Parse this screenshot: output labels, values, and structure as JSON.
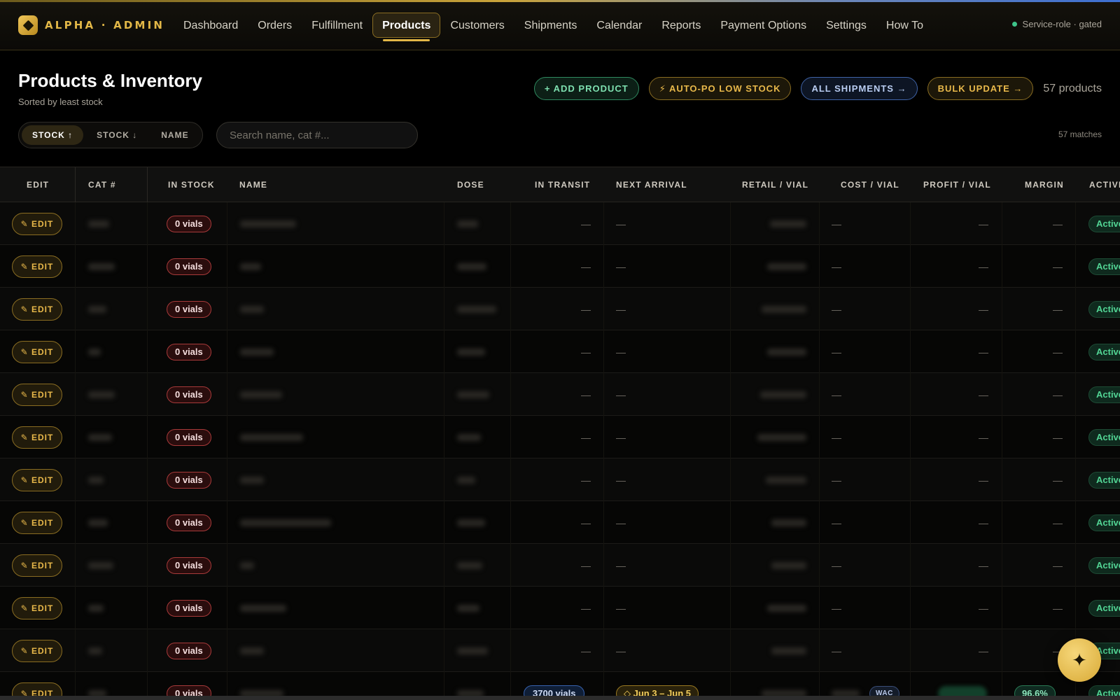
{
  "brand": {
    "name": "ALPHA · ADMIN"
  },
  "nav": {
    "items": [
      {
        "label": "Dashboard",
        "active": false
      },
      {
        "label": "Orders",
        "active": false
      },
      {
        "label": "Fulfillment",
        "active": false
      },
      {
        "label": "Products",
        "active": true
      },
      {
        "label": "Customers",
        "active": false
      },
      {
        "label": "Shipments",
        "active": false
      },
      {
        "label": "Calendar",
        "active": false
      },
      {
        "label": "Reports",
        "active": false
      },
      {
        "label": "Payment Options",
        "active": false
      },
      {
        "label": "Settings",
        "active": false
      },
      {
        "label": "How To",
        "active": false
      }
    ],
    "service_status": "Service-role · gated"
  },
  "page": {
    "title": "Products & Inventory",
    "subtitle": "Sorted by least stock"
  },
  "actions": {
    "add_product": "+ ADD PRODUCT",
    "auto_po": "⚡ AUTO-PO LOW STOCK",
    "all_shipments": "ALL SHIPMENTS →",
    "bulk_update": "BULK UPDATE →",
    "product_count": "57 products"
  },
  "sort": {
    "options": [
      "STOCK ↑",
      "STOCK ↓",
      "NAME"
    ],
    "active_index": 0
  },
  "search": {
    "placeholder": "Search name, cat #...",
    "value": ""
  },
  "matches": "57 matches",
  "table": {
    "columns": [
      "EDIT",
      "CAT #",
      "IN STOCK",
      "NAME",
      "DOSE",
      "IN TRANSIT",
      "NEXT ARRIVAL",
      "RETAIL / VIAL",
      "COST / VIAL",
      "PROFIT / VIAL",
      "MARGIN",
      "ACTIVE"
    ],
    "edit_label": "✎ EDIT",
    "dash": "—",
    "rows": [
      {
        "in_stock": "0 vials",
        "in_transit": "",
        "next_arrival": "",
        "status": "Active"
      },
      {
        "in_stock": "0 vials",
        "in_transit": "",
        "next_arrival": "",
        "status": "Active"
      },
      {
        "in_stock": "0 vials",
        "in_transit": "",
        "next_arrival": "",
        "status": "Active"
      },
      {
        "in_stock": "0 vials",
        "in_transit": "",
        "next_arrival": "",
        "status": "Active"
      },
      {
        "in_stock": "0 vials",
        "in_transit": "",
        "next_arrival": "",
        "status": "Active"
      },
      {
        "in_stock": "0 vials",
        "in_transit": "",
        "next_arrival": "",
        "status": "Active"
      },
      {
        "in_stock": "0 vials",
        "in_transit": "",
        "next_arrival": "",
        "status": "Active"
      },
      {
        "in_stock": "0 vials",
        "in_transit": "",
        "next_arrival": "",
        "status": "Active"
      },
      {
        "in_stock": "0 vials",
        "in_transit": "",
        "next_arrival": "",
        "status": "Active"
      },
      {
        "in_stock": "0 vials",
        "in_transit": "",
        "next_arrival": "",
        "status": "Active"
      },
      {
        "in_stock": "0 vials",
        "in_transit": "",
        "next_arrival": "",
        "status": "Active"
      },
      {
        "in_stock": "0 vials",
        "in_transit": "3700 vials",
        "next_arrival": "◇ Jun 3 – Jun 5",
        "cost_tag": "WAC",
        "margin": "96.6%",
        "status": "Active"
      }
    ]
  },
  "colors": {
    "accent_gold": "#e2b747",
    "active_green": "#52d494",
    "stock_red": "#a83a3a",
    "transit_blue": "#3763b0"
  },
  "icons": {
    "fab": "sparkle-icon",
    "brand": "diamond-logo-icon",
    "status": "status-dot-icon"
  }
}
